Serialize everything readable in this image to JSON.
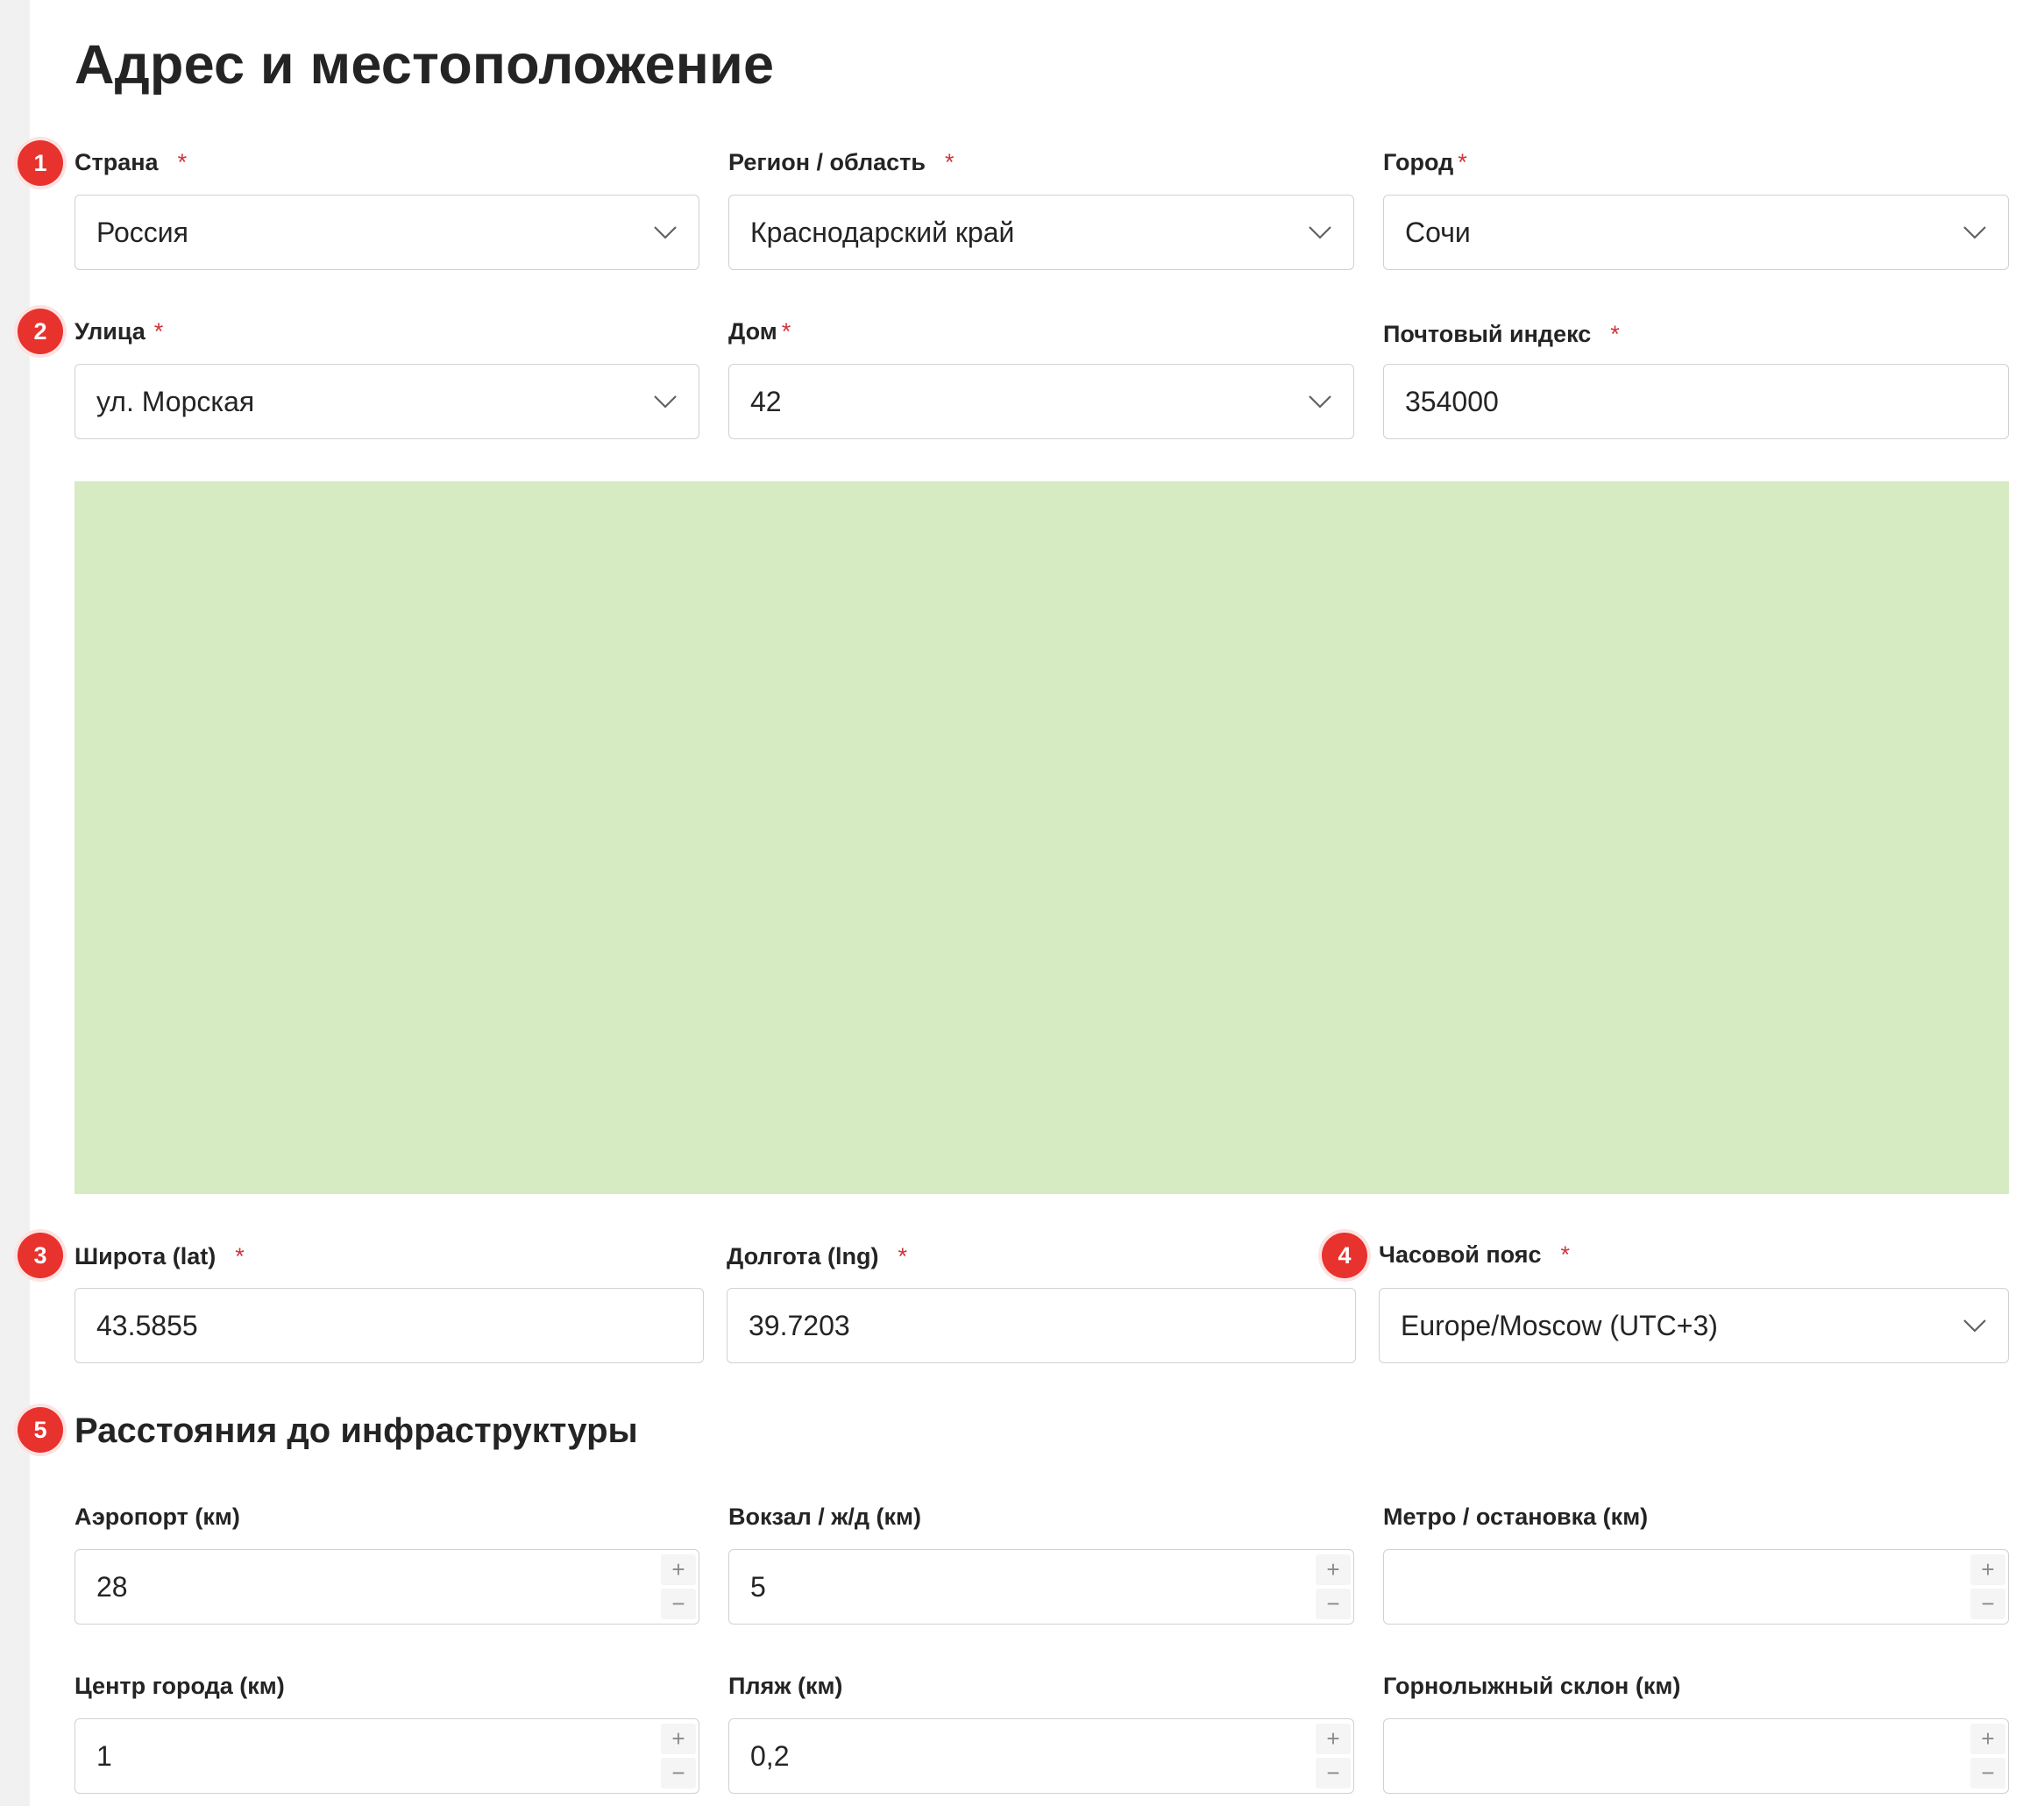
{
  "page": {
    "title": "Адрес и местоположение"
  },
  "badges": [
    "1",
    "2",
    "3",
    "4",
    "5"
  ],
  "required_mark": "*",
  "address": {
    "country": {
      "label": "Страна",
      "value": "Россия"
    },
    "region": {
      "label": "Регион / область",
      "value": "Краснодарский край"
    },
    "city": {
      "label": "Город",
      "value": "Сочи"
    },
    "street": {
      "label": "Улица",
      "value": "ул. Морская"
    },
    "house": {
      "label": "Дом",
      "value": "42"
    },
    "postcode": {
      "label": "Почтовый индекс",
      "value": "354000"
    }
  },
  "coords": {
    "lat": {
      "label": "Широта (lat)",
      "value": "43.5855"
    },
    "lng": {
      "label": "Долгота (lng)",
      "value": "39.7203"
    },
    "timezone": {
      "label": "Часовой пояс",
      "value": "Europe/Moscow (UTC+3)"
    }
  },
  "distances": {
    "title": "Расстояния до инфраструктуры",
    "airport": {
      "label": "Аэропорт (км)",
      "value": "28"
    },
    "station": {
      "label": "Вокзал / ж/д (км)",
      "value": "5"
    },
    "metro": {
      "label": "Метро / остановка (км)",
      "value": ""
    },
    "center": {
      "label": "Центр города (км)",
      "value": "1"
    },
    "beach": {
      "label": "Пляж (км)",
      "value": "0,2"
    },
    "ski": {
      "label": "Горнолыжный склон (км)",
      "value": ""
    }
  },
  "stepper": {
    "plus": "+",
    "minus": "−"
  },
  "colors": {
    "accent_badge": "#e8322e",
    "map_placeholder": "#d7ebc3",
    "required": "#d13438"
  }
}
